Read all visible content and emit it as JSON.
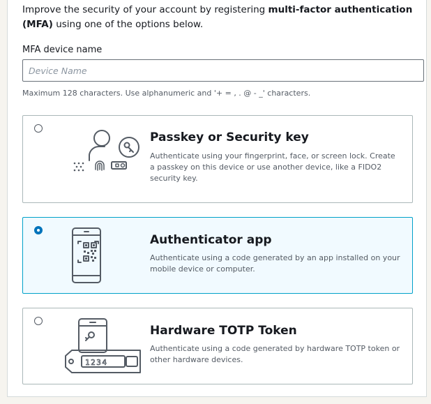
{
  "intro": {
    "text_before": "Improve the security of your account by registering ",
    "text_bold": "multi-factor authentication (MFA)",
    "text_after": " using one of the options below."
  },
  "device_name": {
    "label": "MFA device name",
    "placeholder": "Device Name",
    "value": "",
    "hint": "Maximum 128 characters. Use alphanumeric and '+ = , . @ - _' characters."
  },
  "options": [
    {
      "title": "Passkey or Security key",
      "description": "Authenticate using your fingerprint, face, or screen lock. Create a passkey on this device or use another device, like a FIDO2 security key.",
      "selected": false,
      "icon": "passkey-icon"
    },
    {
      "title": "Authenticator app",
      "description": "Authenticate using a code generated by an app installed on your mobile device or computer.",
      "selected": true,
      "icon": "authenticator-app-icon"
    },
    {
      "title": "Hardware TOTP Token",
      "description": "Authenticate using a code generated by hardware TOTP token or other hardware devices.",
      "selected": false,
      "icon": "hardware-token-icon",
      "token_display": "1234"
    }
  ],
  "colors": {
    "selected_border": "#00a1c9",
    "selected_background": "#f1faff",
    "radio_selected": "#0073bb"
  }
}
